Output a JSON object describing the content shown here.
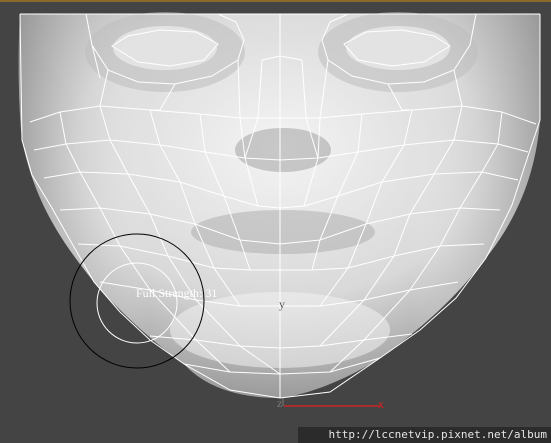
{
  "viewport": {
    "brush_label": "Full Strength: 31",
    "axis_x_label": "x",
    "axis_y_label": "y",
    "axis_z_label": "z"
  },
  "watermark": {
    "text": "http://lccnetvip.pixnet.net/album"
  },
  "colors": {
    "background": "#444444",
    "mesh_wire": "#ffffff",
    "axis_x": "#e02020",
    "brush_outer": "#000000",
    "brush_inner": "#ffffff"
  },
  "icons": {
    "brush_cursor": "circle-brush-icon"
  }
}
